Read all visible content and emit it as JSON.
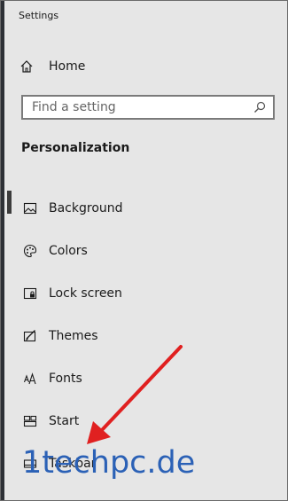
{
  "window": {
    "title": "Settings"
  },
  "nav_home": {
    "label": "Home",
    "icon": "home-icon"
  },
  "search": {
    "placeholder": "Find a setting",
    "value": "",
    "icon": "search-icon"
  },
  "section": {
    "title": "Personalization"
  },
  "nav": {
    "items": [
      {
        "label": "Background",
        "icon": "picture-icon",
        "selected": true
      },
      {
        "label": "Colors",
        "icon": "palette-icon",
        "selected": false
      },
      {
        "label": "Lock screen",
        "icon": "lock-screen-icon",
        "selected": false
      },
      {
        "label": "Themes",
        "icon": "themes-icon",
        "selected": false
      },
      {
        "label": "Fonts",
        "icon": "fonts-icon",
        "selected": false
      },
      {
        "label": "Start",
        "icon": "start-icon",
        "selected": false
      },
      {
        "label": "Taskbar",
        "icon": "taskbar-icon",
        "selected": false
      }
    ]
  },
  "annotation": {
    "arrow_color": "#e02020",
    "watermark": "1techpc.de"
  },
  "colors": {
    "window_bg": "#e6e6e6",
    "text": "#1a1a1a",
    "watermark": "#2b61b6"
  }
}
